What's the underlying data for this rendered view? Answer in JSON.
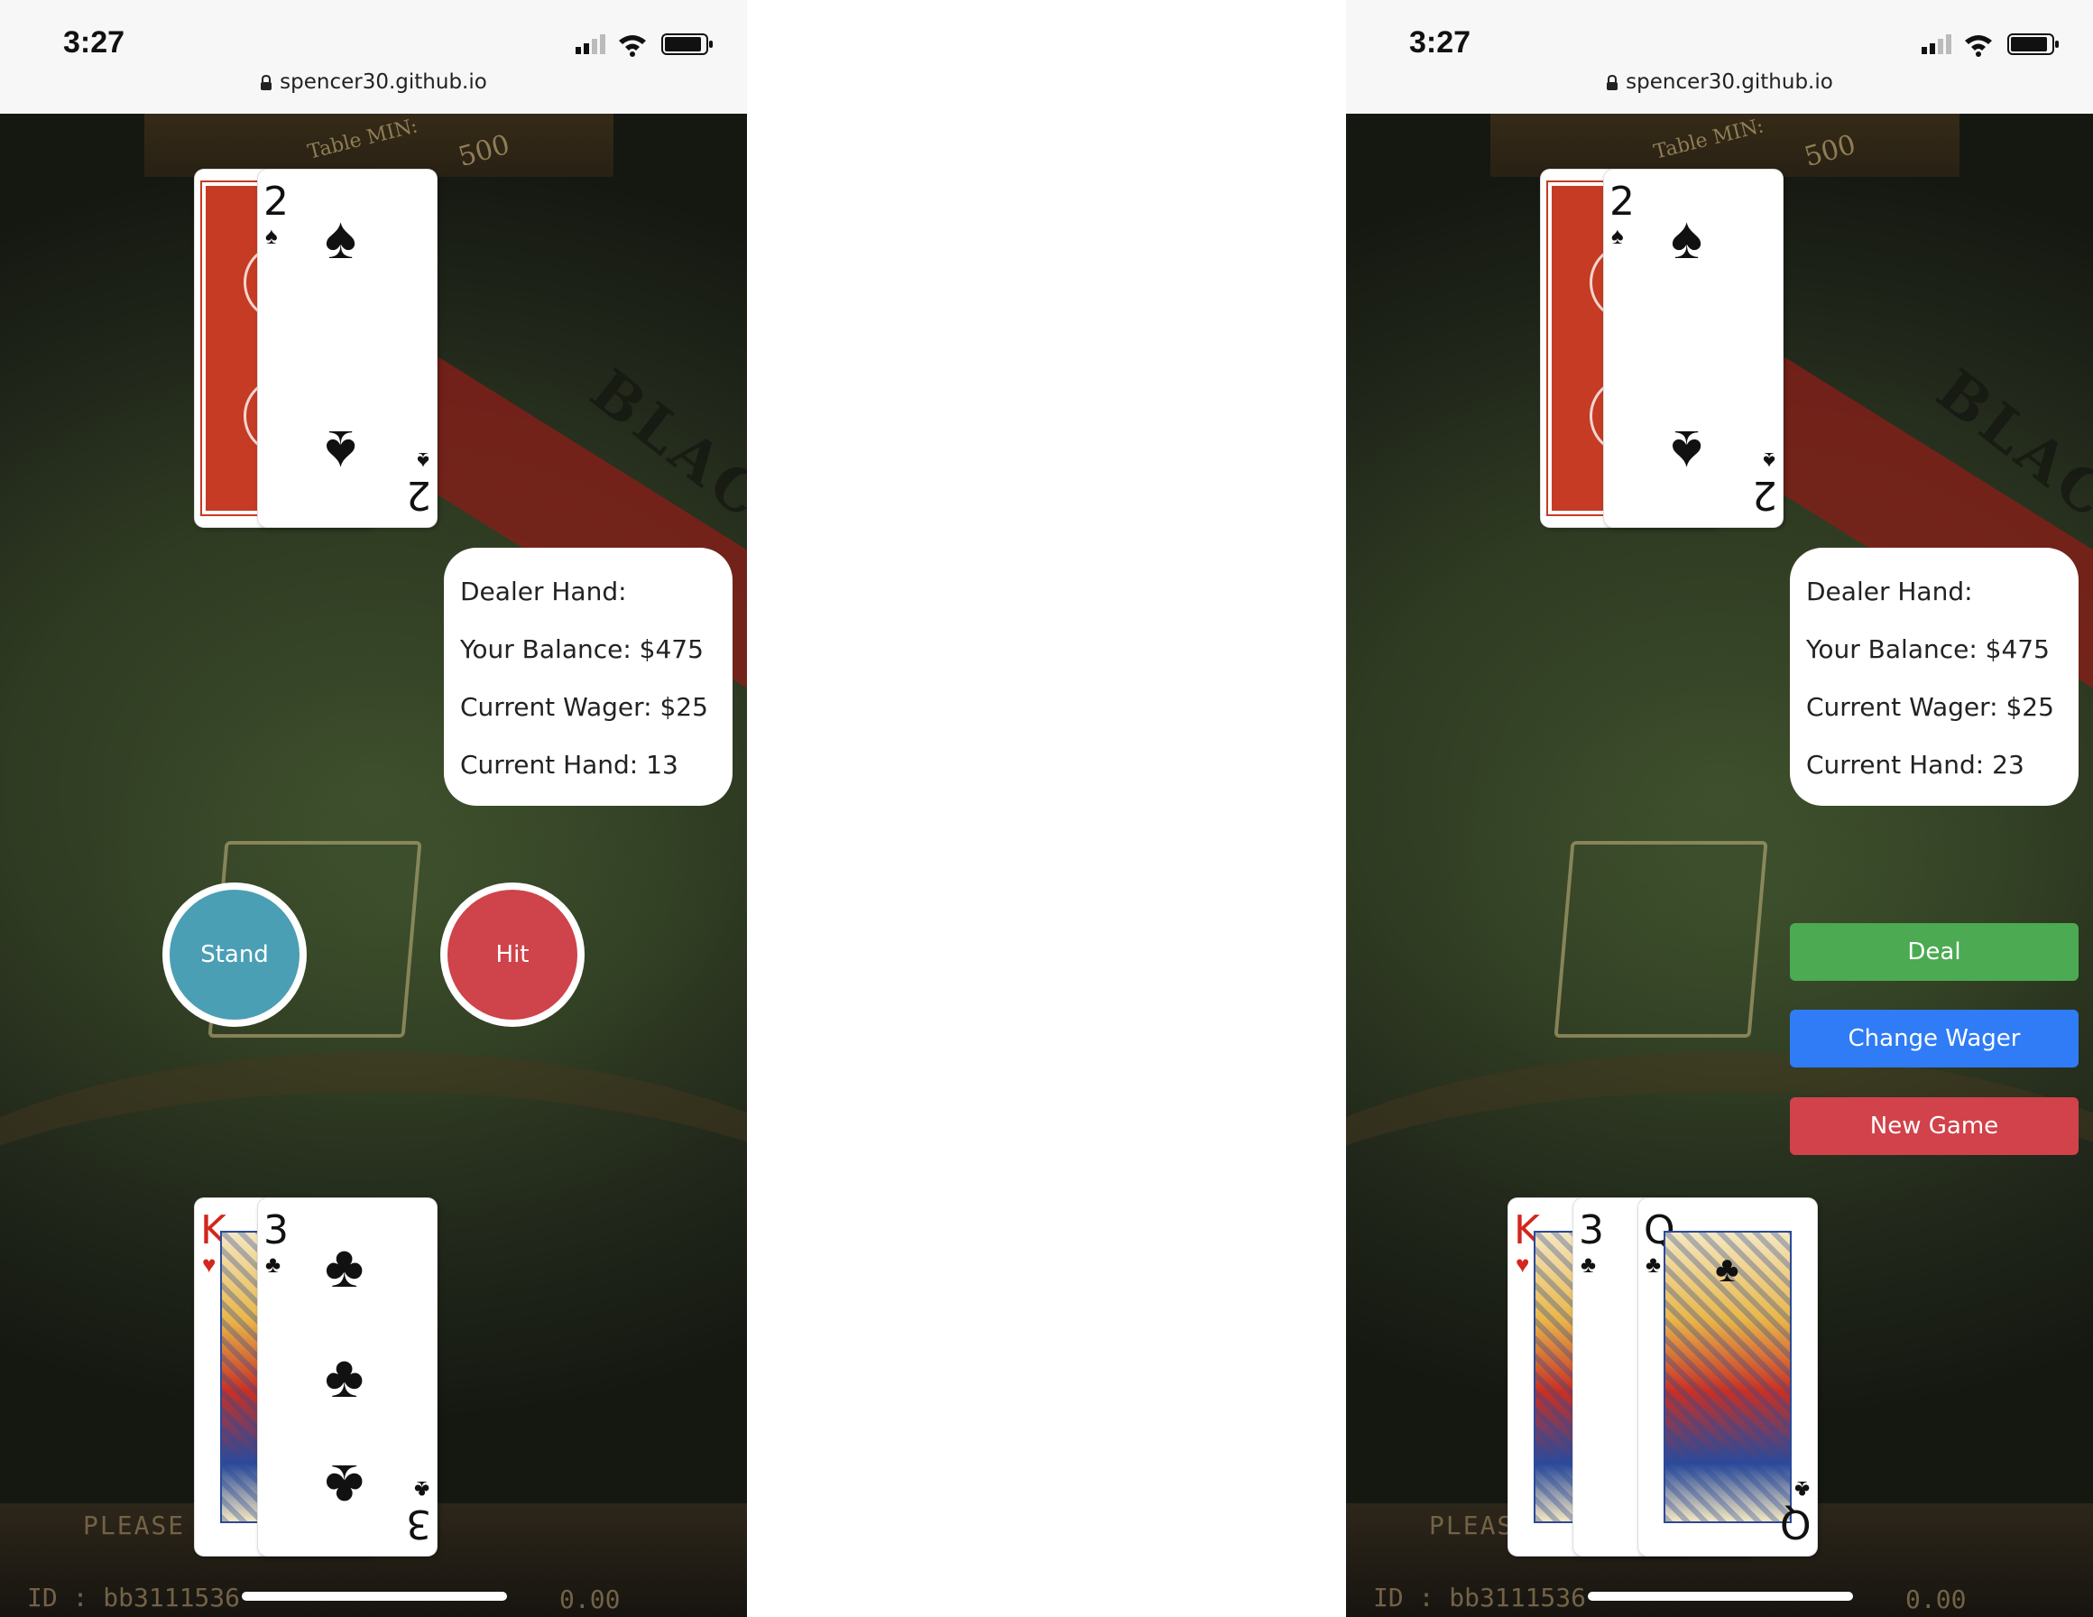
{
  "screens": [
    {
      "status": {
        "time": "3:27",
        "url": "spencer30.github.io"
      },
      "table": {
        "min_label": "MIN:",
        "table_label": "Table",
        "min_value": "500",
        "brand": "BLAC",
        "please": "PLEASE",
        "id_text": "ID : bb3111536",
        "balance_display": "0.00"
      },
      "dealer_cards": [
        {
          "rank": "2",
          "suit": "♠",
          "color": "#111111"
        }
      ],
      "player_cards": [
        {
          "rank": "K",
          "suit": "♥",
          "color": "#d2261e"
        },
        {
          "rank": "3",
          "suit": "♣",
          "color": "#111111"
        }
      ],
      "info": {
        "dealer_hand": "Dealer Hand:",
        "balance": "Your Balance: $475",
        "wager": "Current Wager: $25",
        "current_hand": "Current Hand: 13"
      },
      "actions": {
        "stand": "Stand",
        "hit": "Hit"
      },
      "colors": {
        "stand": "#4a9fb5",
        "hit": "#cf434a"
      }
    },
    {
      "status": {
        "time": "3:27",
        "url": "spencer30.github.io"
      },
      "table": {
        "min_label": "MIN:",
        "table_label": "Table",
        "min_value": "500",
        "brand": "BLAC",
        "please": "PLEAS",
        "id_text": "ID : bb3111536",
        "balance_display": "0.00"
      },
      "dealer_cards": [
        {
          "rank": "2",
          "suit": "♠",
          "color": "#111111"
        }
      ],
      "player_cards": [
        {
          "rank": "K",
          "suit": "♥",
          "color": "#d2261e"
        },
        {
          "rank": "3",
          "suit": "♣",
          "color": "#111111"
        },
        {
          "rank": "Q",
          "suit": "♣",
          "color": "#111111"
        }
      ],
      "info": {
        "dealer_hand": "Dealer Hand:",
        "balance": "Your Balance: $475",
        "wager": "Current Wager: $25",
        "current_hand": "Current Hand: 23"
      },
      "menu": {
        "deal": "Deal",
        "change_wager": "Change Wager",
        "new_game": "New Game"
      },
      "colors": {
        "deal": "#4caa52",
        "change_wager": "#2f7cf6",
        "new_game": "#d1424a"
      }
    }
  ]
}
